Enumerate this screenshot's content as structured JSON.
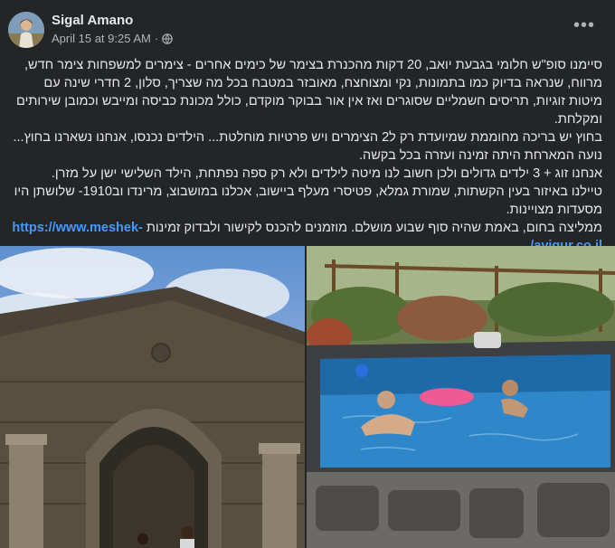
{
  "post": {
    "author": "Sigal Amano",
    "date": "April 15 at 9:25 AM",
    "separator": "·",
    "more_glyph": "•••",
    "icons": {
      "avatar": "profile-avatar",
      "privacy": "globe-icon",
      "more": "more-options-icon"
    },
    "paragraphs": [
      "סיימנו סופ\"ש חלומי בגבעת יואב, 20 דקות מהכנרת בצימר של כימים אחרים - צימרים למשפחות  צימר חדש, מרווח, שנראה בדיוק כמו בתמונות, נקי ומצוחצח, מאובזר במטבח בכל מה שצריך, סלון, 2 חדרי שינה עם מיטות זוגיות, תריסים חשמליים שסוגרים ואז אין אור בבוקר מוקדם, כולל מכונת כביסה ומייבש וכמובן שירותים ומקלחת.",
      "בחוץ יש בריכה מחוממת שמיועדת רק ל2 הצימרים ויש פרטיות מוחלטת... הילדים נכנסו, אנחנו נשארנו בחוץ... נועה המארחת היתה זמינה ועזרה בכל בקשה.",
      "אנחנו זוג + 3 ילדים גדולים ולכן חשוב לנו מיטה לילדים ולא רק ספה נפתחת, הילד השלישי ישן על מזרן.",
      "טיילנו באיזור בעין הקשתות, שמורת גמלא, פטיסרי מעלף ביישוב, אכלנו במושבוצ, מרינדו וב1910- שלושתן היו מסעדות מצויינות."
    ],
    "closing_text": "ממליצה בחום, באמת שהיה סוף שבוע מושלם. מוזמנים להכנס לקישור ולבדוק זמינות",
    "link_text": "https://www.meshek-avigur.co.il/",
    "photos": [
      "ancient-stone-arch-photo",
      "heated-pool-photo"
    ]
  }
}
